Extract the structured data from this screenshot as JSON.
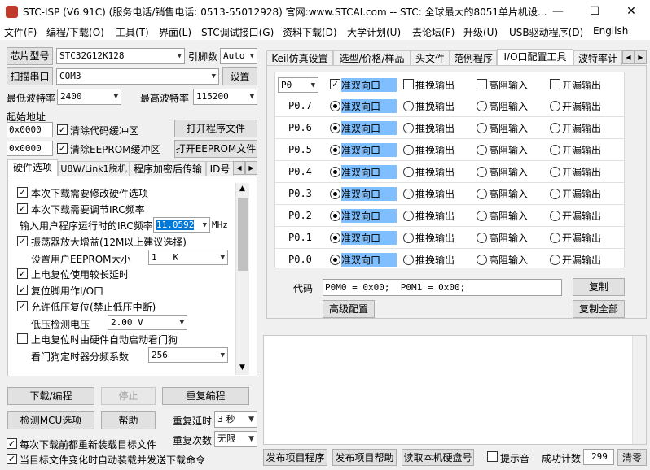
{
  "window": {
    "title": "STC-ISP (V6.91C) (服务电话/销售电话: 0513-55012928) 官网:www.STCAI.com  -- STC: 全球最大的8051单片机设...",
    "minimize": "—",
    "maximize": "☐",
    "close": "✕"
  },
  "menu": [
    "文件(F)",
    "编程/下载(O)",
    "工具(T)",
    "界面(L)",
    "STC调试接口(G)",
    "资料下载(D)",
    "大学计划(U)",
    "去论坛(F)",
    "升级(U)",
    "USB驱动程序(D)",
    "English"
  ],
  "left": {
    "chip_label": "芯片型号",
    "chip_value": "STC32G12K128",
    "pins_label": "引脚数",
    "pins_value": "Auto",
    "scan_port_button": "扫描串口",
    "port_value": "COM3",
    "settings_button": "设置",
    "min_baud_label": "最低波特率",
    "min_baud_value": "2400",
    "max_baud_label": "最高波特率",
    "max_baud_value": "115200",
    "start_addr_label": "起始地址",
    "addr1": "0x0000",
    "clear_code_label": "清除代码缓冲区",
    "open_prog_button": "打开程序文件",
    "addr2": "0x0000",
    "clear_eeprom_label": "清除EEPROM缓冲区",
    "open_eeprom_button": "打开EEPROM文件",
    "tabs": [
      "硬件选项",
      "U8W/Link1脱机",
      "程序加密后传输",
      "ID号"
    ],
    "options": {
      "opt1": "本次下载需要修改硬件选项",
      "opt2": "本次下载需要调节IRC频率",
      "irc_label": "输入用户程序运行时的IRC频率",
      "irc_value": "11.0592",
      "irc_unit": "MHz",
      "opt3": "振荡器放大增益(12M以上建议选择)",
      "eeprom_size_label": "设置用户EEPROM大小",
      "eeprom_size_value": "1   K",
      "opt4": "上电复位使用较长延时",
      "opt5": "复位脚用作I/O口",
      "opt6": "允许低压复位(禁止低压中断)",
      "lvd_label": "低压检测电压",
      "lvd_value": "2.00 V",
      "opt7": "上电复位时由硬件自动启动看门狗",
      "wdt_label": "看门狗定时器分频系数",
      "wdt_value": "256"
    },
    "download_button": "下载/编程",
    "stop_button": "停止",
    "reprogram_button": "重复编程",
    "check_mcu_button": "检测MCU选项",
    "help_button": "帮助",
    "repeat_delay_label": "重复延时",
    "repeat_delay_value": "3 秒",
    "repeat_count_label": "重复次数",
    "repeat_count_value": "无限",
    "reload_label": "每次下载前都重新装载目标文件",
    "autoload_label": "当目标文件变化时自动装载并发送下载命令"
  },
  "right": {
    "tabs": [
      "Keil仿真设置",
      "选型/价格/样品",
      "头文件",
      "范例程序",
      "I/O口配置工具",
      "波特率计"
    ],
    "port_select": "P0",
    "header_options": [
      "准双向口",
      "推挽输出",
      "高阻输入",
      "开漏输出"
    ],
    "pins": [
      "P0.7",
      "P0.6",
      "P0.5",
      "P0.4",
      "P0.3",
      "P0.2",
      "P0.1",
      "P0.0"
    ],
    "code_label": "代码",
    "code_value": "P0M0 = 0x00;  P0M1 = 0x00;",
    "copy_button": "复制",
    "advanced_button": "高级配置",
    "copy_all_button": "复制全部",
    "publish_button": "发布项目程序",
    "publish_help_button": "发布项目帮助",
    "read_disk_button": "读取本机硬盘号",
    "sound_label": "提示音",
    "success_label": "成功计数",
    "success_value": "299",
    "clear_button": "清零"
  }
}
